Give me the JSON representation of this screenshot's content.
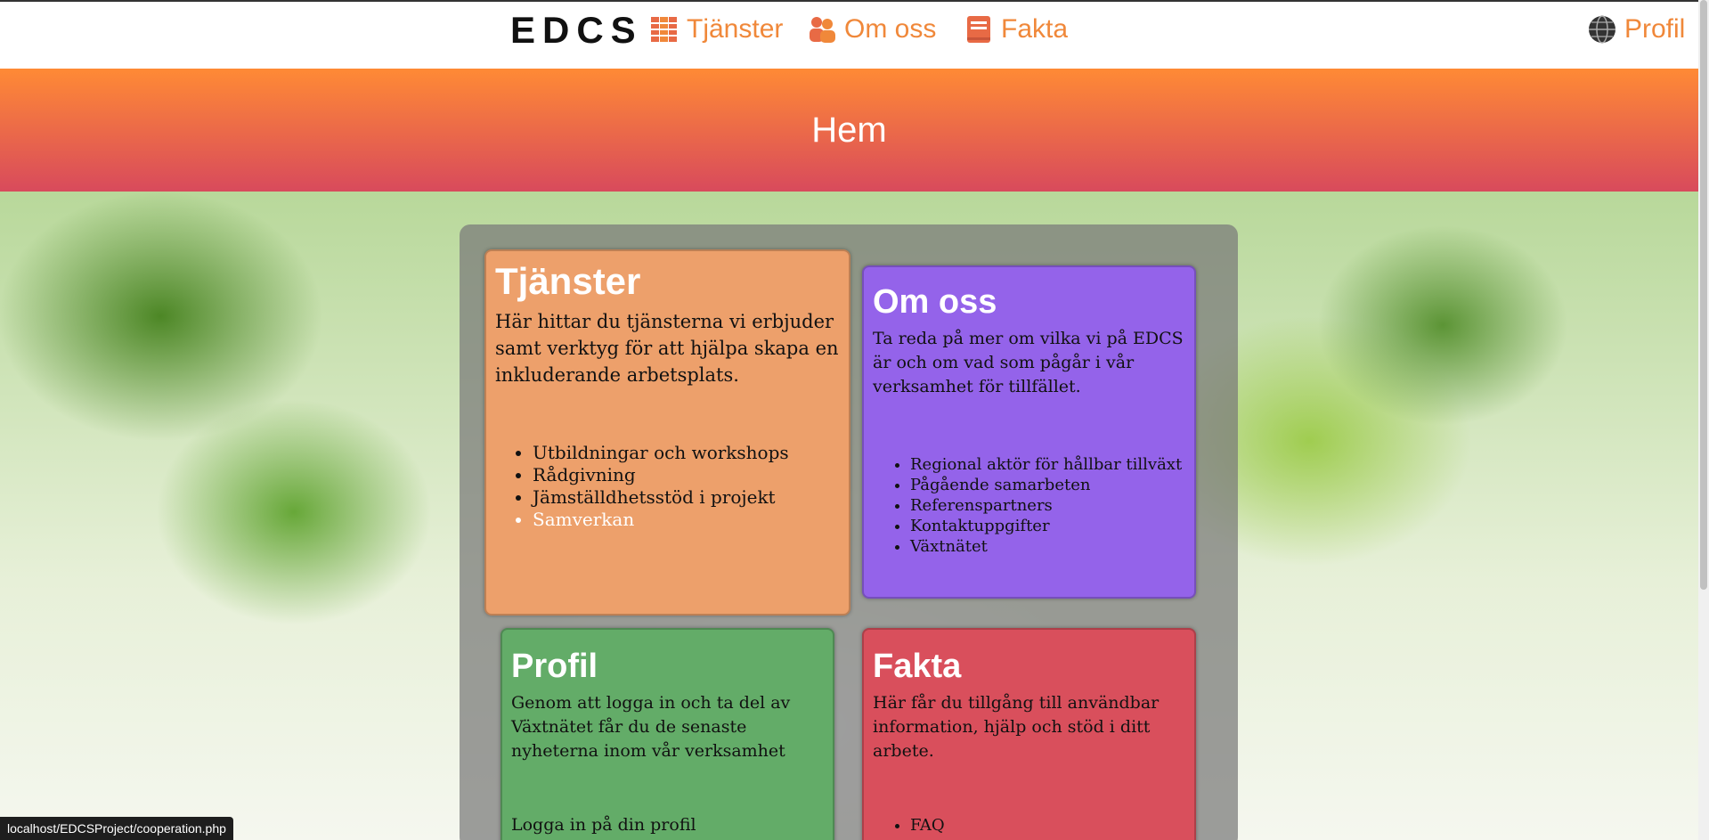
{
  "nav": {
    "logo": "EDCS",
    "items": [
      {
        "label": "Tjänster",
        "icon": "book-stack-icon"
      },
      {
        "label": "Om oss",
        "icon": "people-icon"
      },
      {
        "label": "Fakta",
        "icon": "book-icon"
      }
    ],
    "profile": {
      "label": "Profil",
      "icon": "globe-icon"
    },
    "accent_color": "#f0883a"
  },
  "hero": {
    "title": "Hem"
  },
  "cards": {
    "tjanster": {
      "title": "Tjänster",
      "text": "Här hittar du tjänsterna vi erbjuder samt verktyg för att hjälpa skapa en inkluderande arbetsplats.",
      "items": [
        "Utbildningar och workshops",
        "Rådgivning",
        "Jämställdhetsstöd i projekt",
        "Samverkan"
      ],
      "color": "#eda06b"
    },
    "omoss": {
      "title": "Om oss",
      "text": "Ta reda på mer om vilka vi på EDCS är och om vad som pågår i vår verksamhet för tillfället.",
      "items": [
        "Regional aktör för hållbar tillväxt",
        "Pågående samarbeten",
        "Referenspartners",
        "Kontaktuppgifter",
        "Växtnätet"
      ],
      "color": "#9463ea"
    },
    "profil": {
      "title": "Profil",
      "text": "Genom att logga in och ta del av Växtnätet får du de senaste nyheterna inom vår verksamhet",
      "link": "Logga in på din profil",
      "color": "#63ac68"
    },
    "fakta": {
      "title": "Fakta",
      "text": "Här får du tillgång till användbar information, hjälp och stöd i ditt arbete.",
      "items": [
        "FAQ"
      ],
      "color": "#d94f5c"
    }
  },
  "status_url": "localhost/EDCSProject/cooperation.php"
}
